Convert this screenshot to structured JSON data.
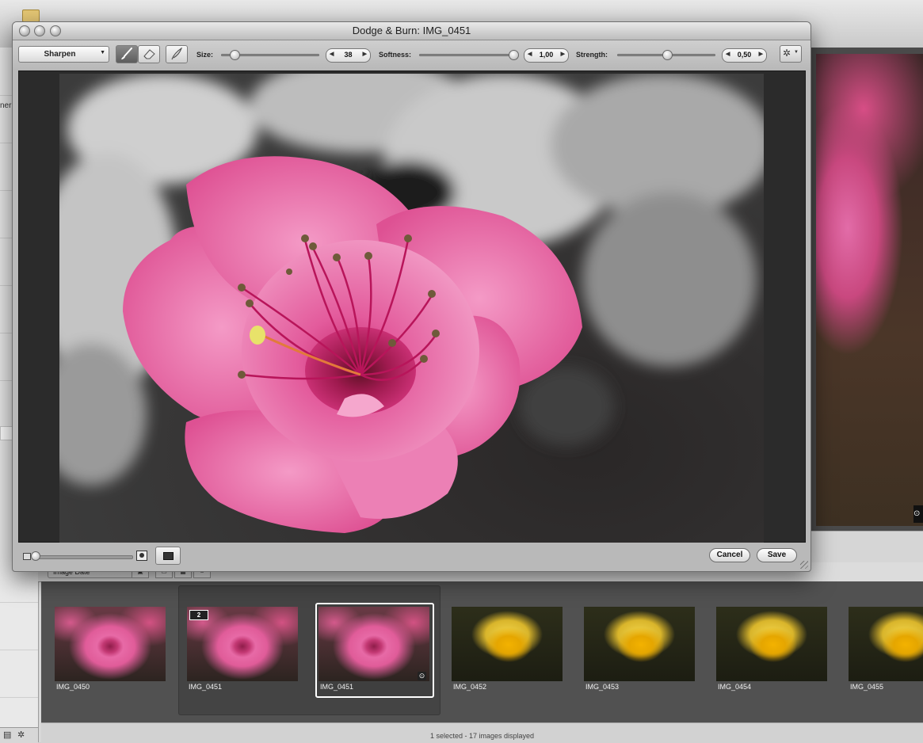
{
  "background": {
    "left_panel_label": "ner",
    "sort_select": "Image Date",
    "viewer_badge": "⊙",
    "status": "1 selected - 17 images displayed",
    "filmstrip": [
      {
        "label": "IMG_0450",
        "tone": "pink",
        "selected": false,
        "stack_badge": ""
      },
      {
        "label": "IMG_0451",
        "tone": "pink",
        "selected": false,
        "stack_badge": "2"
      },
      {
        "label": "IMG_0451",
        "tone": "pink",
        "selected": true,
        "stack_badge": ""
      },
      {
        "label": "IMG_0452",
        "tone": "yellow",
        "selected": false,
        "stack_badge": ""
      },
      {
        "label": "IMG_0453",
        "tone": "yellow",
        "selected": false,
        "stack_badge": ""
      },
      {
        "label": "IMG_0454",
        "tone": "yellow",
        "selected": false,
        "stack_badge": ""
      },
      {
        "label": "IMG_0455",
        "tone": "yellow",
        "selected": false,
        "stack_badge": ""
      }
    ]
  },
  "dialog": {
    "title": "Dodge & Burn: IMG_0451",
    "mode": "Sharpen",
    "tools": [
      "brush-icon",
      "eraser-icon",
      "feather-icon"
    ],
    "size": {
      "label": "Size:",
      "value": "38",
      "slider_fraction": 0.1
    },
    "softness": {
      "label": "Softness:",
      "value": "1,00",
      "slider_fraction": 1.0
    },
    "strength": {
      "label": "Strength:",
      "value": "0,50",
      "slider_fraction": 0.5
    },
    "cancel_label": "Cancel",
    "save_label": "Save",
    "zoom_fraction": 0.0
  },
  "colors": {
    "flower_pink": "#e35b9c",
    "flower_dark": "#a3174f",
    "daffodil_yellow": "#f2c400"
  }
}
